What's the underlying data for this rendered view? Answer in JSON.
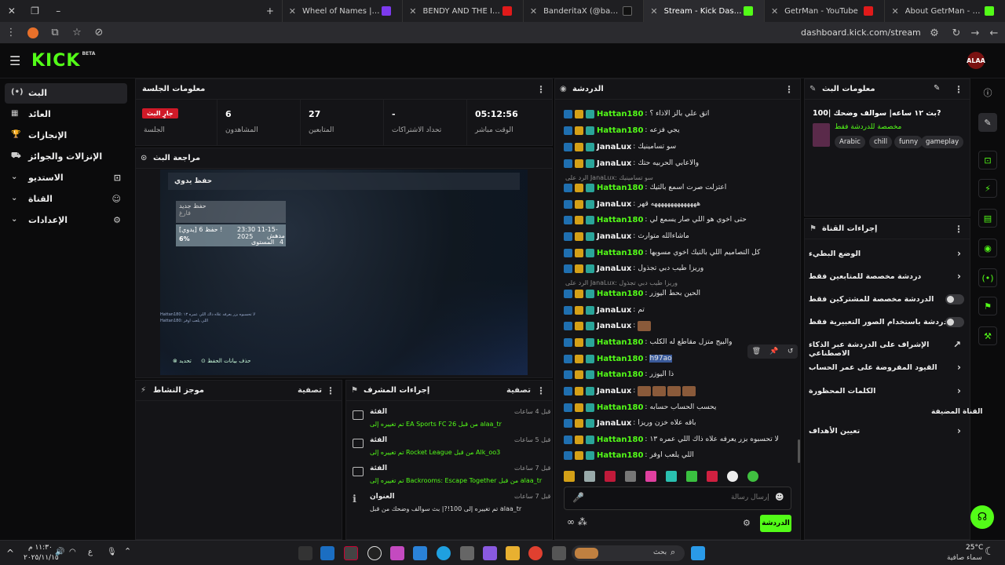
{
  "browser": {
    "tabs": [
      {
        "title": "Wheel of Names | الإسم العشوائي",
        "color": "#3b82f6"
      },
      {
        "title": "BENDY AND THE INK MACHINE",
        "color": "#e01a1a"
      },
      {
        "title": "BanderitaX (@banderitax) الرسمي",
        "color": "#111111"
      },
      {
        "title": "Stream - Kick Dashboard",
        "color": "#53fc18",
        "active": true
      },
      {
        "title": "GetrMan - YouTube",
        "color": "#e01a1a"
      },
      {
        "title": "About GetrMan - Watch Live on",
        "color": "#53fc18"
      }
    ],
    "url": "dashboard.kick.com/stream"
  },
  "header": {
    "logo": "KICK",
    "logo_badge": "BETA",
    "avatar_text": "ALAA"
  },
  "sidebar": {
    "items": [
      {
        "label": "البث",
        "icon": "(•)"
      },
      {
        "label": "العائد",
        "icon": "▦"
      },
      {
        "label": "الإنجازات",
        "icon": "🏆"
      },
      {
        "label": "الإنزالات والجوائز",
        "icon": "⛟"
      },
      {
        "label": "الاستديو",
        "icon": "⌄"
      },
      {
        "label": "القناة",
        "icon": "⌄"
      },
      {
        "label": "الإعدادات",
        "icon": "⌄"
      }
    ]
  },
  "session": {
    "title": "معلومات الجلسة",
    "live_badge": "جارٍ البث",
    "live_sub": "الجلسة",
    "stats": [
      {
        "value": "6",
        "label": "المشاهدون"
      },
      {
        "value": "27",
        "label": "المتابعين"
      },
      {
        "value": "-",
        "label": "تحداد الاشتراكات"
      },
      {
        "value": "05:12:56",
        "label": "الوقت مباشر"
      }
    ]
  },
  "preview": {
    "title": "مراجعة البث",
    "overlay_title": "حفظ يدوي",
    "save_new": "حفظ جديد",
    "save_empty": "فارغ",
    "save_slot": "حفظ 6 [يدوي] !",
    "save_date": "23:30 11-15-2025",
    "save_sub": "مدهش",
    "save_level_label": "المستوى",
    "save_level": "4",
    "save_pct": "6%",
    "footer_select": "تحديد",
    "footer_delete": "حذف بيانات الحفظ",
    "mini_chat_1": "Hattan180: لا تحسبوه بزر يعرفه علاه ذاك اللي عمره ١٣",
    "mini_chat_2": "Hattan180: اللي يلعب اوفر"
  },
  "activity": {
    "title": "موجز النشاط",
    "filter": "تصفية"
  },
  "modactions": {
    "title": "إجراءات المشرف",
    "filter": "تصفية",
    "items": [
      {
        "kind": "الفئة",
        "time": "قبل 4 ساعات",
        "text": "تم تغييره إلى EA Sports FC 26 من قبل alaa_tr"
      },
      {
        "kind": "الفئة",
        "time": "قبل 5 ساعات",
        "text": "تم تغييره إلى Rocket League من قبل Alk_oo3"
      },
      {
        "kind": "الفئة",
        "time": "قبل 7 ساعات",
        "text": "تم تغييره إلى Backrooms: Escape Together من قبل alaa_tr"
      },
      {
        "kind": "العنوان",
        "time": "قبل 7 ساعات",
        "text": "تم تغييره إلى 100!?| بث سوالف وضحك من قبل alaa_tr"
      }
    ]
  },
  "chat": {
    "title": "الدردشة",
    "messages": [
      {
        "user": "Hattan180",
        "text": "اتق علي بالز الاذاء ؟"
      },
      {
        "user": "Hattan180",
        "text": "يجي فزعه"
      },
      {
        "user": "JanaLux",
        "text": "سو تسامينيك"
      },
      {
        "user": "JanaLux",
        "text": "والاعابي الحربيه حتك"
      },
      {
        "user": "Hattan180",
        "text": "اعتزلت صرت اسمع بالتيك"
      },
      {
        "user": "JanaLux",
        "text": "ههههههههههههههه قهر"
      },
      {
        "user": "Hattan180",
        "text": "حتى اخوي هو اللي صار يسمع لي"
      },
      {
        "user": "JanaLux",
        "text": "ماشاءالله متوارث"
      },
      {
        "user": "Hattan180",
        "text": "كل التصاميم اللي بالتيك اخوي مسويها"
      },
      {
        "user": "JanaLux",
        "text": "وريزا طيب دبي تجذول"
      },
      {
        "user": "Hattan180",
        "text": "الحين بحط اليوزر"
      },
      {
        "user": "JanaLux",
        "text": "تم"
      },
      {
        "user": "JanaLux",
        "text": ""
      },
      {
        "user": "Hattan180",
        "text": "والبيج متزل مقاطع له الكلب"
      },
      {
        "user": "Hattan180",
        "text": "h97ao"
      },
      {
        "user": "Hattan180",
        "text": "ذا اليوزر"
      },
      {
        "user": "JanaLux",
        "text": ""
      },
      {
        "user": "Hattan180",
        "text": "يحسب الحساب حسابه"
      },
      {
        "user": "JanaLux",
        "text": "باقه علاه خزن وريزا"
      },
      {
        "user": "Hattan180",
        "text": "لا تحسبوه بزر يعرفه علاه ذاك اللي عمره ١٣"
      },
      {
        "user": "Hattan180",
        "text": "اللي يلعب اوفر"
      }
    ],
    "reply_1": "الرد على JanaLux: سو تسامينيك",
    "reply_2": "الرد على JanaLux: وريزا طيب دبي تجذول",
    "input_placeholder": "إرسال رسالة",
    "send_label": "الدردشة"
  },
  "streaminfo": {
    "title": "معلومات البث",
    "stream_title": "بث ١٢ ساعه| سوالف وضحك |100?",
    "category": "مخصصة للدردشة فقط",
    "tags": [
      "Arabic",
      "chill",
      "funny",
      "gameplay"
    ]
  },
  "channelactions": {
    "title": "إجراءات القناة",
    "items": [
      {
        "label": "الوضع البطيء",
        "type": "link"
      },
      {
        "label": "دردشة مخصصة للمتابعين فقط",
        "type": "link"
      },
      {
        "label": "الدردشة مخصصة للمشتركين فقط",
        "type": "toggle"
      },
      {
        "label": "الدردشة باستخدام الصور التعبيرية فقط",
        "type": "toggle"
      },
      {
        "label": "الإشراف على الدردشة عبر الذكاء الاصطناعي",
        "type": "ext"
      },
      {
        "label": "القيود المفروضة على عمر الحساب",
        "type": "link"
      },
      {
        "label": "الكلمات المحظورة",
        "type": "link"
      }
    ],
    "hosting_label": "القناة المضيفة",
    "goals_label": "تعيين الأهداف"
  },
  "taskbar": {
    "time": "١١:٣٠ م",
    "date": "٢٠٢٥/١١/١٥",
    "lang": "ع",
    "search": "بحث",
    "weather_temp": "25°C",
    "weather_desc": "سماء صافية"
  },
  "colors": {
    "brand": "#53fc18",
    "live": "#d01a28"
  }
}
